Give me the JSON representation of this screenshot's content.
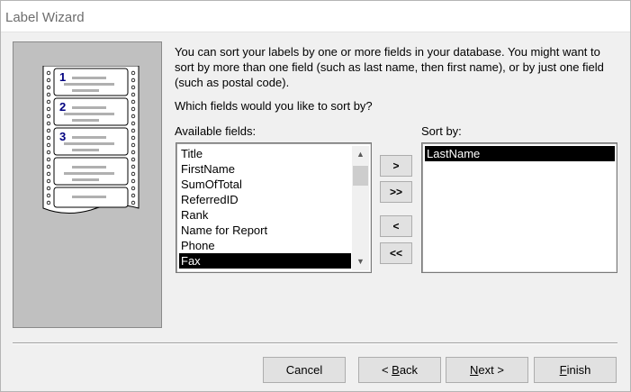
{
  "window": {
    "title": "Label Wizard"
  },
  "instructions": {
    "paragraph": "You can sort your labels by one or more fields in your database.  You might want to sort by more than one field (such as last name, then first name), or by just one field (such as postal code).",
    "question": "Which fields would you like to sort by?"
  },
  "illustration": {
    "label_numbers": [
      "1",
      "2",
      "3"
    ]
  },
  "available_fields": {
    "label": "Available fields:",
    "items": [
      "Title",
      "FirstName",
      "SumOfTotal",
      "ReferredID",
      "Rank",
      "Name for Report",
      "Phone",
      "Fax"
    ],
    "selected": "Fax"
  },
  "sort_by": {
    "label": "Sort by:",
    "items": [
      "LastName"
    ],
    "selected": "LastName"
  },
  "move_buttons": {
    "add": ">",
    "add_all": ">>",
    "remove": "<",
    "remove_all": "<<"
  },
  "footer": {
    "cancel": "Cancel",
    "back_prefix": "< ",
    "back_mnemonic": "B",
    "back_rest": "ack",
    "next_mnemonic": "N",
    "next_rest": "ext >",
    "finish_mnemonic": "F",
    "finish_rest": "inish"
  },
  "colors": {
    "selection_bg": "#000000",
    "selection_fg": "#ffffff",
    "panel_bg": "#c0c0c0",
    "label_number": "#000080"
  }
}
